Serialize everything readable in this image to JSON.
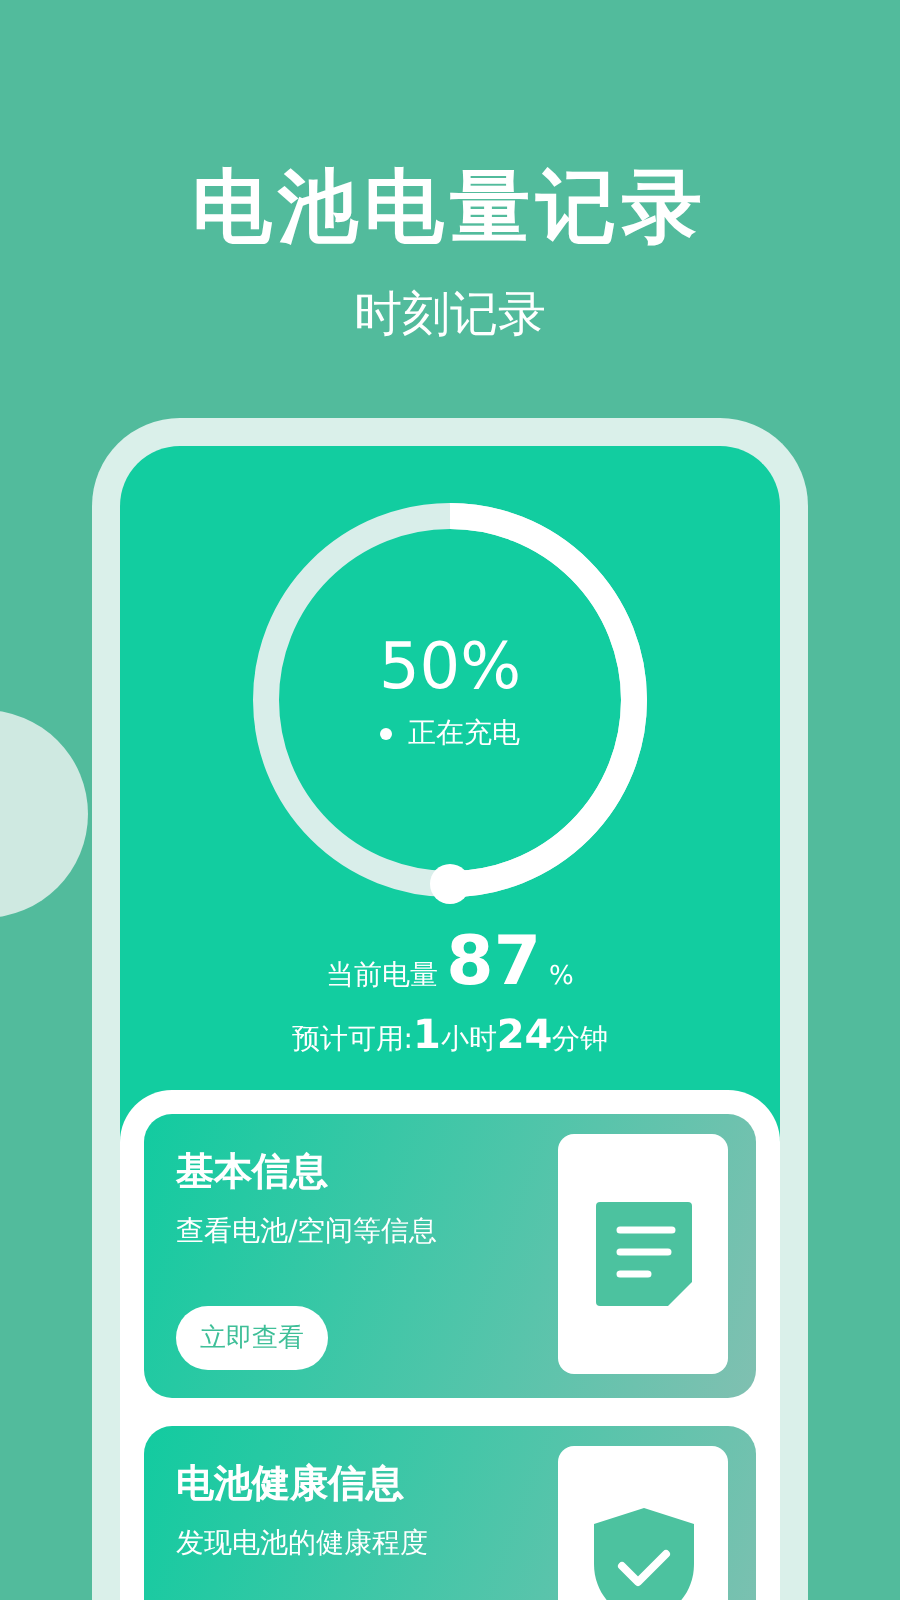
{
  "header": {
    "title": "电池电量记录",
    "subtitle": "时刻记录"
  },
  "battery": {
    "ring": {
      "level": 0.5,
      "percent": "50%",
      "status": "正在充电"
    },
    "current_label": "当前电量",
    "current_value": "87",
    "current_unit": "%",
    "estimate_label": "预计可用:",
    "estimate_hours": "1",
    "hours_unit": "小时",
    "estimate_minutes": "24",
    "minutes_unit": "分钟"
  },
  "cards": [
    {
      "kind": "document",
      "title": "基本信息",
      "description": "查看电池/空间等信息",
      "button": "立即查看"
    },
    {
      "kind": "shield",
      "title": "电池健康信息",
      "description": "发现电池的健康程度"
    }
  ]
}
